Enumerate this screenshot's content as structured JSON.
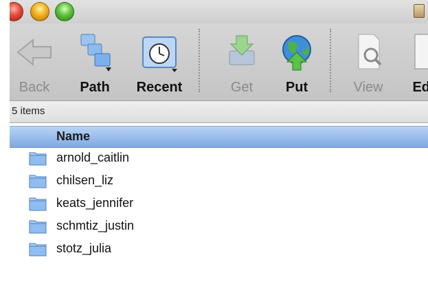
{
  "toolbar": {
    "buttons": [
      {
        "label": "Back",
        "icon": "back-arrow-icon",
        "enabled": false
      },
      {
        "label": "Path",
        "icon": "path-folders-icon",
        "enabled": true
      },
      {
        "label": "Recent",
        "icon": "recent-clock-folder-icon",
        "enabled": true
      },
      {
        "label": "Get",
        "icon": "get-download-icon",
        "enabled": false
      },
      {
        "label": "Put",
        "icon": "put-globe-upload-icon",
        "enabled": true
      },
      {
        "label": "View",
        "icon": "view-document-icon",
        "enabled": false
      },
      {
        "label": "Edi",
        "icon": "edit-document-icon",
        "enabled": true
      }
    ]
  },
  "status": {
    "item_count": "5 items"
  },
  "list": {
    "column_header": "Name",
    "items": [
      {
        "name": "arnold_caitlin"
      },
      {
        "name": "chilsen_liz"
      },
      {
        "name": "keats_jennifer"
      },
      {
        "name": "schmtiz_justin"
      },
      {
        "name": "stotz_julia"
      }
    ]
  }
}
